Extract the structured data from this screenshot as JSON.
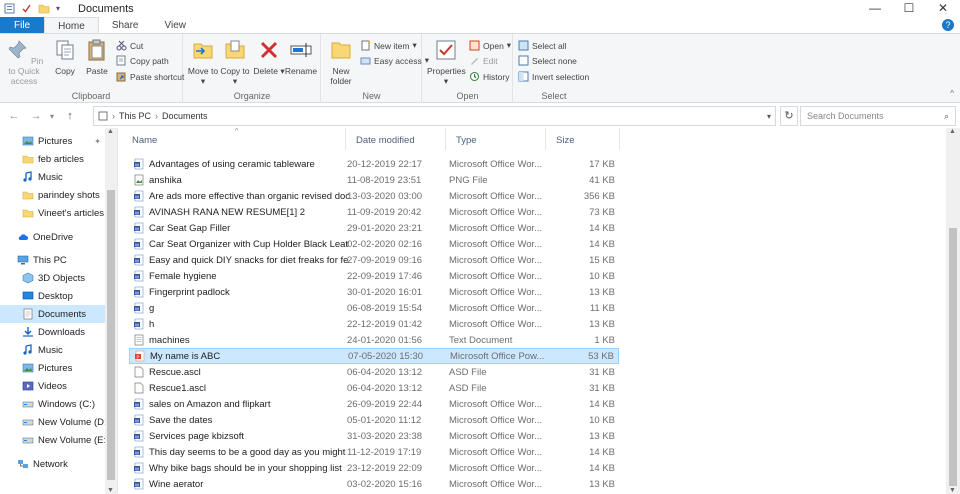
{
  "window": {
    "title": "Documents"
  },
  "tabs": [
    "File",
    "Home",
    "Share",
    "View"
  ],
  "ribbon": {
    "clipboard": {
      "label": "Clipboard",
      "pin": "Pin to Quick access",
      "copy": "Copy",
      "paste": "Paste",
      "cut": "Cut",
      "copy_path": "Copy path",
      "paste_shortcut": "Paste shortcut"
    },
    "organize": {
      "label": "Organize",
      "move_to": "Move to",
      "copy_to": "Copy to",
      "delete": "Delete",
      "rename": "Rename"
    },
    "new": {
      "label": "New",
      "new_folder": "New folder",
      "new_item": "New item",
      "easy_access": "Easy access"
    },
    "open": {
      "label": "Open",
      "properties": "Properties",
      "open": "Open",
      "edit": "Edit",
      "history": "History"
    },
    "select": {
      "label": "Select",
      "select_all": "Select all",
      "select_none": "Select none",
      "invert": "Invert selection"
    }
  },
  "address": {
    "crumbs": [
      "This PC",
      "Documents"
    ],
    "search_placeholder": "Search Documents"
  },
  "nav": [
    {
      "label": "Pictures",
      "icon": "pictures-icon"
    },
    {
      "label": "feb articles",
      "icon": "folder-icon"
    },
    {
      "label": "Music",
      "icon": "music-icon"
    },
    {
      "label": "parindey shots",
      "icon": "folder-icon"
    },
    {
      "label": "Vineet's articles",
      "icon": "folder-icon"
    },
    {
      "label": "OneDrive",
      "icon": "cloud-icon"
    },
    {
      "label": "This PC",
      "icon": "pc-icon"
    },
    {
      "label": "3D Objects",
      "icon": "cube-icon"
    },
    {
      "label": "Desktop",
      "icon": "desktop-icon"
    },
    {
      "label": "Documents",
      "icon": "documents-icon"
    },
    {
      "label": "Downloads",
      "icon": "download-icon"
    },
    {
      "label": "Music",
      "icon": "music-icon"
    },
    {
      "label": "Pictures",
      "icon": "pictures-icon"
    },
    {
      "label": "Videos",
      "icon": "video-icon"
    },
    {
      "label": "Windows (C:)",
      "icon": "drive-icon"
    },
    {
      "label": "New Volume (D:)",
      "icon": "drive-icon"
    },
    {
      "label": "New Volume (E:)",
      "icon": "drive-icon"
    },
    {
      "label": "Network",
      "icon": "network-icon"
    }
  ],
  "columns": {
    "name": "Name",
    "date": "Date modified",
    "type": "Type",
    "size": "Size"
  },
  "files": [
    {
      "name": "Advantages of using ceramic tableware",
      "date": "20-12-2019 22:17",
      "type": "Microsoft Office Wor...",
      "size": "17 KB",
      "icon": "word-icon"
    },
    {
      "name": "anshika",
      "date": "11-08-2019 23:51",
      "type": "PNG File",
      "size": "41 KB",
      "icon": "image-file-icon"
    },
    {
      "name": "Are ads more effective than organic revised doc",
      "date": "13-03-2020 03:00",
      "type": "Microsoft Office Wor...",
      "size": "356 KB",
      "icon": "word-icon"
    },
    {
      "name": "AVINASH RANA NEW RESUME[1] 2",
      "date": "11-09-2019 20:42",
      "type": "Microsoft Office Wor...",
      "size": "73 KB",
      "icon": "word-icon"
    },
    {
      "name": "Car Seat Gap Filler",
      "date": "29-01-2020 23:21",
      "type": "Microsoft Office Wor...",
      "size": "14 KB",
      "icon": "word-icon"
    },
    {
      "name": "Car Seat Organizer with Cup Holder Black Leather",
      "date": "02-02-2020 02:16",
      "type": "Microsoft Office Wor...",
      "size": "14 KB",
      "icon": "word-icon"
    },
    {
      "name": "Easy and quick DIY snacks for diet freaks for fes...",
      "date": "27-09-2019 09:16",
      "type": "Microsoft Office Wor...",
      "size": "15 KB",
      "icon": "word-icon"
    },
    {
      "name": "Female hygiene",
      "date": "22-09-2019 17:46",
      "type": "Microsoft Office Wor...",
      "size": "10 KB",
      "icon": "word-icon"
    },
    {
      "name": "Fingerprint padlock",
      "date": "30-01-2020 16:01",
      "type": "Microsoft Office Wor...",
      "size": "13 KB",
      "icon": "word-icon"
    },
    {
      "name": "g",
      "date": "06-08-2019 15:54",
      "type": "Microsoft Office Wor...",
      "size": "11 KB",
      "icon": "word-icon"
    },
    {
      "name": "h",
      "date": "22-12-2019 01:42",
      "type": "Microsoft Office Wor...",
      "size": "13 KB",
      "icon": "word-icon"
    },
    {
      "name": "machines",
      "date": "24-01-2020 01:56",
      "type": "Text Document",
      "size": "1 KB",
      "icon": "text-file-icon"
    },
    {
      "name": "My name is ABC",
      "date": "07-05-2020 15:30",
      "type": "Microsoft Office Pow...",
      "size": "53 KB",
      "icon": "powerpoint-icon",
      "selected": true
    },
    {
      "name": "Rescue.ascl",
      "date": "06-04-2020 13:12",
      "type": "ASD File",
      "size": "31 KB",
      "icon": "generic-file-icon"
    },
    {
      "name": "Rescue1.ascl",
      "date": "06-04-2020 13:12",
      "type": "ASD File",
      "size": "31 KB",
      "icon": "generic-file-icon"
    },
    {
      "name": "sales on Amazon and flipkart",
      "date": "26-09-2019 22:44",
      "type": "Microsoft Office Wor...",
      "size": "14 KB",
      "icon": "word-icon"
    },
    {
      "name": "Save the dates",
      "date": "05-01-2020 11:12",
      "type": "Microsoft Office Wor...",
      "size": "10 KB",
      "icon": "word-icon"
    },
    {
      "name": "Services page kbizsoft",
      "date": "31-03-2020 23:38",
      "type": "Microsoft Office Wor...",
      "size": "13 KB",
      "icon": "word-icon"
    },
    {
      "name": "This day seems to be a good day as you might ...",
      "date": "11-12-2019 17:19",
      "type": "Microsoft Office Wor...",
      "size": "14 KB",
      "icon": "word-icon"
    },
    {
      "name": "Why bike bags should be in your shopping list",
      "date": "23-12-2019 22:09",
      "type": "Microsoft Office Wor...",
      "size": "14 KB",
      "icon": "word-icon"
    },
    {
      "name": "Wine aerator",
      "date": "03-02-2020 15:16",
      "type": "Microsoft Office Wor...",
      "size": "13 KB",
      "icon": "word-icon"
    }
  ]
}
